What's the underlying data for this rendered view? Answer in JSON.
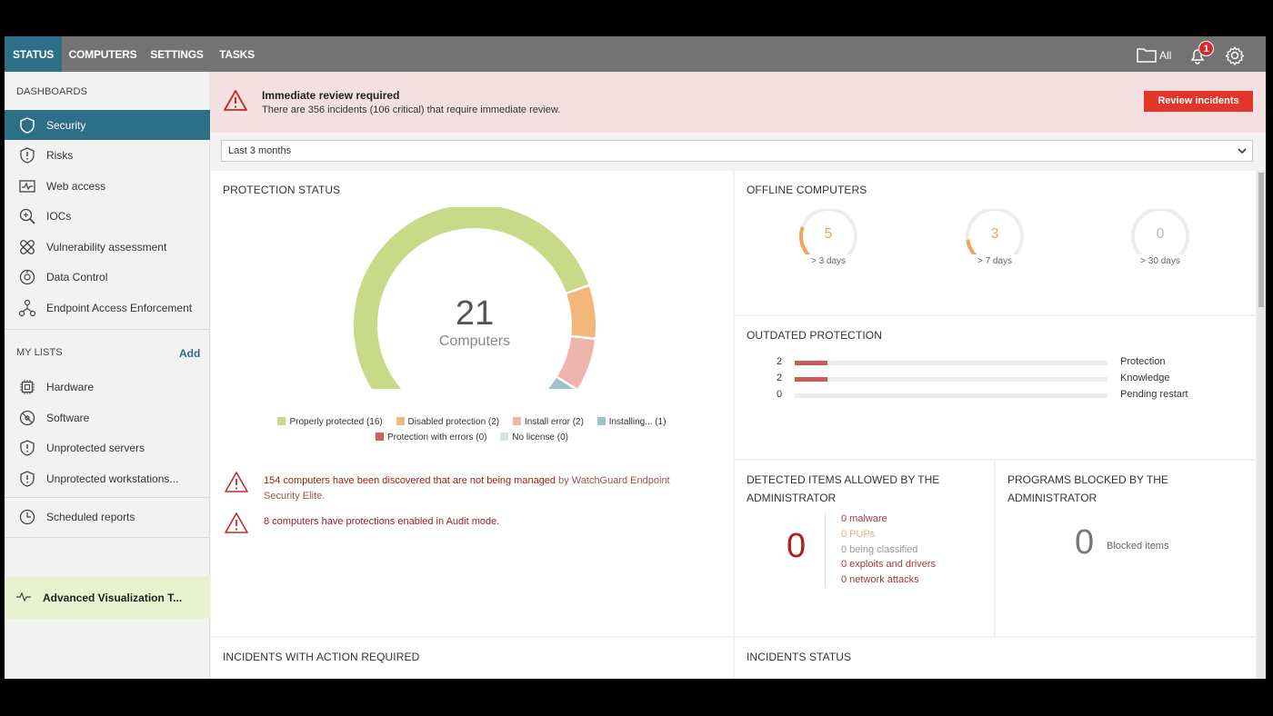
{
  "nav": {
    "tabs": [
      {
        "label": "STATUS"
      },
      {
        "label": "COMPUTERS"
      },
      {
        "label": "SETTINGS"
      },
      {
        "label": "TASKS"
      }
    ],
    "filter_label": "All",
    "notification_count": "1"
  },
  "sidebar": {
    "dashboards_heading": "DASHBOARDS",
    "dashboards": [
      {
        "label": "Security",
        "icon": "shield-icon"
      },
      {
        "label": "Risks",
        "icon": "shield-alert-icon"
      },
      {
        "label": "Web access",
        "icon": "pulse-icon"
      },
      {
        "label": "IOCs",
        "icon": "magnify-icon"
      },
      {
        "label": "Vulnerability assessment",
        "icon": "bandage-icon"
      },
      {
        "label": "Data Control",
        "icon": "data-icon"
      },
      {
        "label": "Endpoint Access Enforcement",
        "icon": "network-icon"
      }
    ],
    "lists_heading": "MY LISTS",
    "add_label": "Add",
    "lists": [
      {
        "label": "Hardware",
        "icon": "chip-icon"
      },
      {
        "label": "Software",
        "icon": "disc-icon"
      },
      {
        "label": "Unprotected servers",
        "icon": "shield-alert-icon"
      },
      {
        "label": "Unprotected workstations...",
        "icon": "shield-alert-icon"
      }
    ],
    "scheduled_reports": "Scheduled reports",
    "advanced": "Advanced Visualization T..."
  },
  "alert": {
    "title": "Immediate review required",
    "text": "There are 356 incidents (106 critical) that require immediate review.",
    "button": "Review incidents"
  },
  "date_filter": {
    "value": "Last 3 months"
  },
  "protection": {
    "title": "PROTECTION STATUS",
    "total": "21",
    "total_label": "Computers",
    "legend": [
      {
        "label": "Properly protected (16)",
        "color": "#c8d987"
      },
      {
        "label": "Disabled protection (2)",
        "color": "#f4b77a"
      },
      {
        "label": "Install error (2)",
        "color": "#efb5ac"
      },
      {
        "label": "Installing... (1)",
        "color": "#9dc3c8"
      },
      {
        "label": "Protection with errors (0)",
        "color": "#cf5f63"
      },
      {
        "label": "No license (0)",
        "color": "#d7e2e6"
      }
    ],
    "warning1_main": "154 computers have been discovered that are not being managed",
    "warning1_tail": " by WatchGuard Endpoint Security Elite.",
    "warning2": "8 computers have protections enabled in Audit mode."
  },
  "chart_data": {
    "type": "pie",
    "title": "PROTECTION STATUS",
    "categories": [
      "Properly protected",
      "Disabled protection",
      "Install error",
      "Installing...",
      "Protection with errors",
      "No license"
    ],
    "values": [
      16,
      2,
      2,
      1,
      0,
      0
    ],
    "colors": [
      "#c8d987",
      "#f4b77a",
      "#efb5ac",
      "#9dc3c8",
      "#cf5f63",
      "#d7e2e6"
    ]
  },
  "offline": {
    "title": "OFFLINE COMPUTERS",
    "items": [
      {
        "value": "5",
        "label": "> 3 days",
        "fraction": 0.24,
        "color": "#f0a55d"
      },
      {
        "value": "3",
        "label": "> 7 days",
        "fraction": 0.14,
        "color": "#f0a55d"
      },
      {
        "value": "0",
        "label": "> 30 days",
        "fraction": 0,
        "color": "#cccccc"
      }
    ]
  },
  "outdated": {
    "title": "OUTDATED PROTECTION",
    "rows": [
      {
        "value": "2",
        "label": "Protection",
        "fraction": 0.105
      },
      {
        "value": "2",
        "label": "Knowledge",
        "fraction": 0.105
      },
      {
        "value": "0",
        "label": "Pending restart",
        "fraction": 0
      }
    ]
  },
  "detected": {
    "title": "DETECTED ITEMS ALLOWED BY THE ADMINISTRATOR",
    "total": "0",
    "lines": [
      {
        "text": "0 malware",
        "color": "#9b3b3b"
      },
      {
        "text": "0 PUPs",
        "color": "#e0b07a"
      },
      {
        "text": "0 being classified",
        "color": "#999999"
      },
      {
        "text": "0 exploits and drivers",
        "color": "#9b3b3b"
      },
      {
        "text": "0 network attacks",
        "color": "#9b3b3b"
      }
    ]
  },
  "blocked": {
    "title": "PROGRAMS BLOCKED BY THE ADMINISTRATOR",
    "total": "0",
    "label": "Blocked items"
  },
  "incidents_action": {
    "title": "INCIDENTS WITH ACTION REQUIRED"
  },
  "incidents_status": {
    "title": "INCIDENTS STATUS"
  }
}
